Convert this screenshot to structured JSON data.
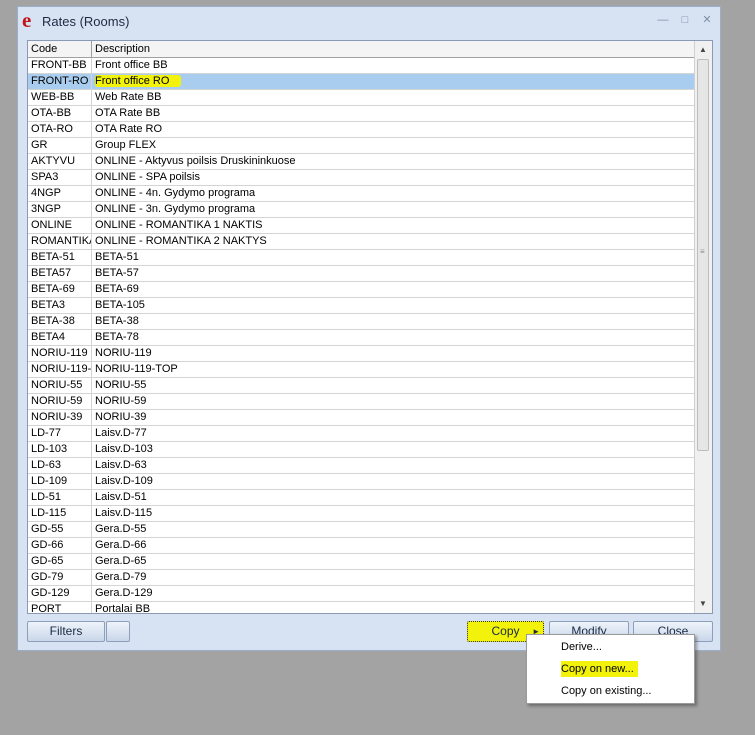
{
  "window": {
    "title": "Rates (Rooms)",
    "app_icon_glyph": "e",
    "controls": {
      "minimize": "—",
      "restore": "□",
      "close": "✕"
    }
  },
  "grid": {
    "columns": [
      "Code",
      "Description"
    ],
    "selected_index": 1,
    "rows": [
      [
        "FRONT-BB",
        "Front office BB"
      ],
      [
        "FRONT-RO",
        "Front office RO"
      ],
      [
        "WEB-BB",
        "Web Rate BB"
      ],
      [
        "OTA-BB",
        "OTA Rate BB"
      ],
      [
        "OTA-RO",
        "OTA Rate RO"
      ],
      [
        "GR",
        "Group FLEX"
      ],
      [
        "AKTYVU",
        "ONLINE - Aktyvus poilsis Druskininkuose"
      ],
      [
        "SPA3",
        "ONLINE - SPA poilsis"
      ],
      [
        "4NGP",
        "ONLINE - 4n. Gydymo programa"
      ],
      [
        "3NGP",
        "ONLINE - 3n. Gydymo programa"
      ],
      [
        "ONLINE",
        "ONLINE - ROMANTIKA 1 NAKTIS"
      ],
      [
        "ROMANTIKA",
        "ONLINE - ROMANTIKA 2 NAKTYS"
      ],
      [
        "BETA-51",
        "BETA-51"
      ],
      [
        "BETA57",
        "BETA-57"
      ],
      [
        "BETA-69",
        "BETA-69"
      ],
      [
        "BETA3",
        "BETA-105"
      ],
      [
        "BETA-38",
        "BETA-38"
      ],
      [
        "BETA4",
        "BETA-78"
      ],
      [
        "NORIU-119",
        "NORIU-119"
      ],
      [
        "NORIU-119-",
        "NORIU-119-TOP"
      ],
      [
        "NORIU-55",
        "NORIU-55"
      ],
      [
        "NORIU-59",
        "NORIU-59"
      ],
      [
        "NORIU-39",
        "NORIU-39"
      ],
      [
        "LD-77",
        "Laisv.D-77"
      ],
      [
        "LD-103",
        "Laisv.D-103"
      ],
      [
        "LD-63",
        "Laisv.D-63"
      ],
      [
        "LD-109",
        "Laisv.D-109"
      ],
      [
        "LD-51",
        "Laisv.D-51"
      ],
      [
        "LD-115",
        "Laisv.D-115"
      ],
      [
        "GD-55",
        "Gera.D-55"
      ],
      [
        "GD-66",
        "Gera.D-66"
      ],
      [
        "GD-65",
        "Gera.D-65"
      ],
      [
        "GD-79",
        "Gera.D-79"
      ],
      [
        "GD-129",
        "Gera.D-129"
      ],
      [
        "PORT",
        "Portalai BB"
      ]
    ]
  },
  "footer": {
    "filters_label": "Filters",
    "extra_label": "",
    "copy_label": "Copy",
    "modify_label": "Modify",
    "close_label": "Close"
  },
  "copy_menu": {
    "items": [
      "Derive...",
      "Copy on new...",
      "Copy on existing..."
    ],
    "highlighted_index": 1
  },
  "colors": {
    "highlight": "#f2f20a",
    "selection": "#a9cdee",
    "window_bg": "#d7e3f2",
    "desktop_bg": "#a3a3a3"
  }
}
